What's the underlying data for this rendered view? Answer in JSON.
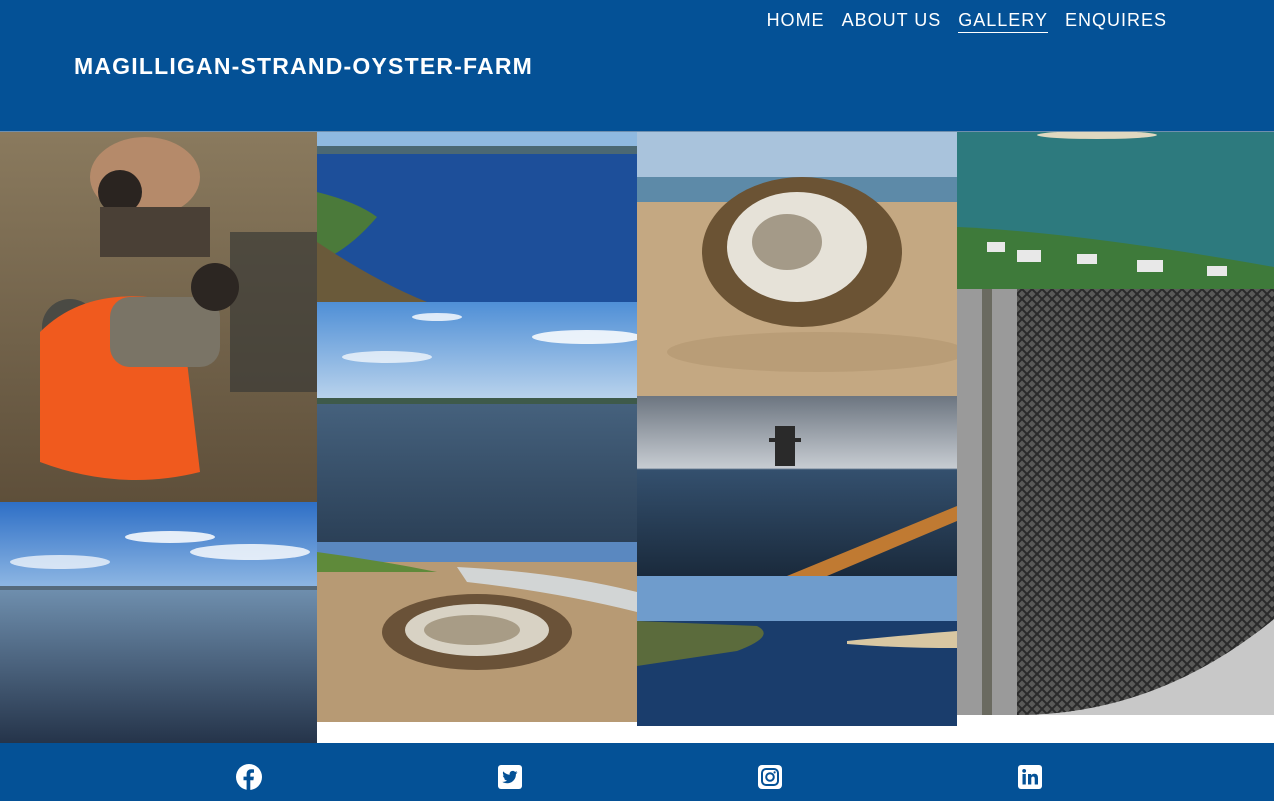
{
  "brand": {
    "title": "MAGILLIGAN-STRAND-OYSTER-FARM"
  },
  "nav": {
    "items": [
      {
        "label": "HOME"
      },
      {
        "label": "ABOUT US"
      },
      {
        "label": "GALLERY",
        "active": true
      },
      {
        "label": "ENQUIRES"
      }
    ]
  },
  "colors": {
    "brand_blue": "#045196",
    "text": "#ffffff"
  },
  "footer": {
    "icons": [
      "facebook-icon",
      "twitter-icon",
      "instagram-icon",
      "linkedin-icon"
    ]
  }
}
